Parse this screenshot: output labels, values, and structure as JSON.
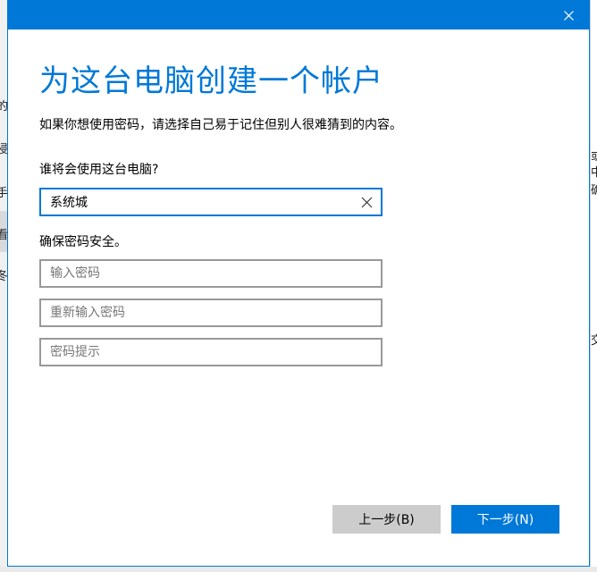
{
  "background_left_fragments": [
    "的",
    "浸",
    "手",
    "看",
    "冬"
  ],
  "background_right_fragments": [
    "或",
    "中",
    "确",
    "交"
  ],
  "dialog": {
    "heading": "为这台电脑创建一个帐户",
    "intro": "如果你想使用密码，请选择自己易于记住但别人很难猜到的内容。",
    "who_label": "谁将会使用这台电脑?",
    "username_value": "系统城",
    "security_label": "确保密码安全。",
    "password_placeholder": "输入密码",
    "reenter_placeholder": "重新输入密码",
    "hint_placeholder": "密码提示",
    "back_button": "上一步(B)",
    "next_button": "下一步(N)"
  },
  "colors": {
    "accent": "#0078d7",
    "back_button_bg": "#cccccc",
    "input_border": "#999999"
  },
  "icons": {
    "close": "close-icon",
    "clear": "clear-text-icon"
  }
}
